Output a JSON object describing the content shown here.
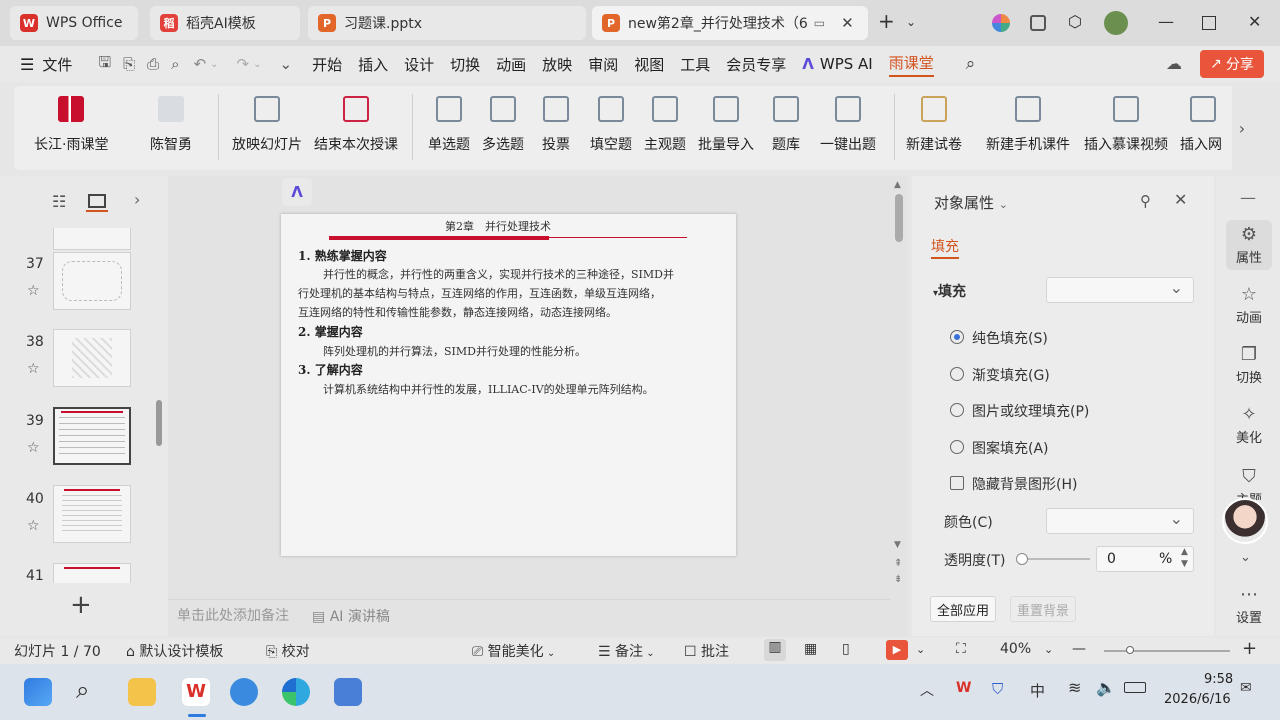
{
  "tabs": [
    {
      "label": "WPS Office",
      "icon": "wps-logo-icon"
    },
    {
      "label": "稻壳AI模板",
      "icon": "docer-icon"
    },
    {
      "label": "习题课.pptx",
      "icon": "ppt-icon"
    },
    {
      "label": "new第2章_并行处理技术（6",
      "icon": "ppt-icon"
    }
  ],
  "menu": {
    "file": "文件",
    "items": [
      "开始",
      "插入",
      "设计",
      "切换",
      "动画",
      "放映",
      "审阅",
      "视图",
      "工具",
      "会员专享"
    ],
    "wps_ai": "WPS AI",
    "rain": "雨课堂",
    "share": "分享"
  },
  "ribbon": {
    "items": [
      "长江·雨课堂",
      "陈智勇",
      "放映幻灯片",
      "结束本次授课",
      "单选题",
      "多选题",
      "投票",
      "填空题",
      "主观题",
      "批量导入",
      "题库",
      "一键出题",
      "新建试卷",
      "新建手机课件",
      "插入慕课视频",
      "插入网"
    ]
  },
  "thumbs": [
    {
      "num": "37"
    },
    {
      "num": "38"
    },
    {
      "num": "39"
    },
    {
      "num": "40"
    },
    {
      "num": "41"
    }
  ],
  "slide": {
    "header": "第2章　并行处理技术",
    "h1": "1. 熟练掌握内容",
    "p1_1": "并行性的概念，并行性的两重含义，实现并行技术的三种途径，SIMD并",
    "p1_2": "行处理机的基本结构与特点，互连网络的作用，互连函数，单级互连网络，",
    "p1_3": "互连网络的特性和传输性能参数，静态连接网络，动态连接网络。",
    "h2": "2. 掌握内容",
    "p2": "阵列处理机的并行算法，SIMD并行处理的性能分析。",
    "h3": "3. 了解内容",
    "p3": "计算机系统结构中并行性的发展，ILLIAC-IV的处理单元阵列结构。"
  },
  "notes": {
    "placeholder": "单击此处添加备注",
    "ai": "AI 演讲稿"
  },
  "props": {
    "title": "对象属性",
    "tab": "填充",
    "section": "填充",
    "options": [
      "纯色填充(S)",
      "渐变填充(G)",
      "图片或纹理填充(P)",
      "图案填充(A)"
    ],
    "selected_option": 0,
    "hide_bg": "隐藏背景图形(H)",
    "color_label": "颜色(C)",
    "transparency_label": "透明度(T)",
    "transparency_value": "0",
    "transparency_unit": "%",
    "apply_all": "全部应用",
    "reset_bg": "重置背景"
  },
  "sidebar": [
    "属性",
    "动画",
    "切换",
    "美化",
    "主题",
    "设置"
  ],
  "status": {
    "slide_info": "幻灯片 1 / 70",
    "template": "默认设计模板",
    "proof": "校对",
    "beautify": "智能美化",
    "notes": "备注",
    "comments": "批注",
    "zoom": "40%"
  },
  "taskbar": {
    "ime": "中",
    "time": "9:58",
    "date": "2026/6/16"
  },
  "colors": {
    "accent_red": "#c8102e",
    "share_orange": "#e8553a",
    "rain_orange": "#d4541e",
    "radio_blue": "#3a6fd8"
  }
}
